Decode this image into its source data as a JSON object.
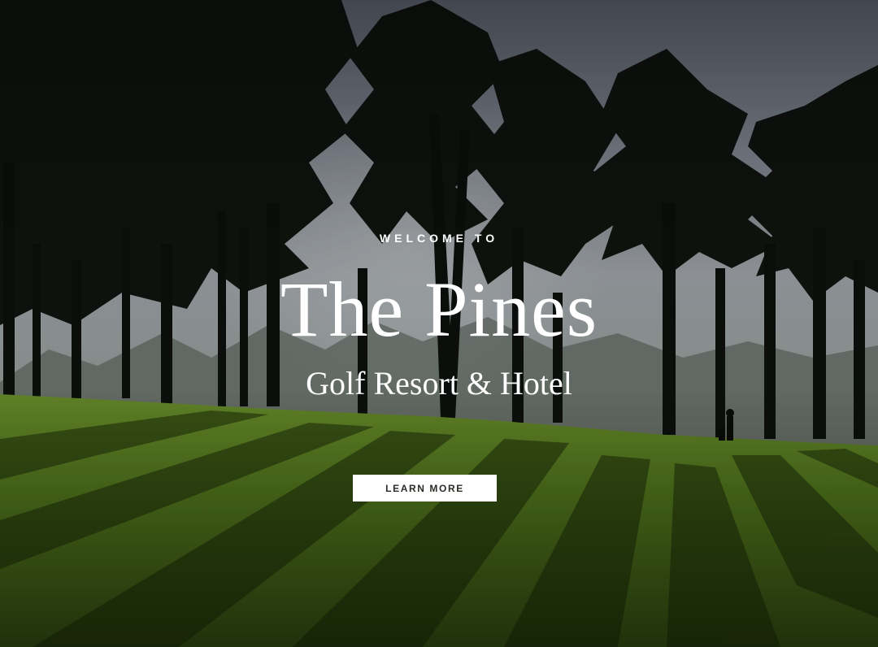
{
  "hero": {
    "eyebrow": "WELCOME TO",
    "title": "The Pines",
    "subtitle": "Golf Resort & Hotel",
    "cta_label": "LEARN MORE",
    "background_image": "golf-course-pine-trees-photo"
  },
  "colors": {
    "text": "#ffffff",
    "button_bg": "#ffffff",
    "button_text": "#2e2a26",
    "grass": "#6f9a2a",
    "sky": "#9aa4b4"
  }
}
